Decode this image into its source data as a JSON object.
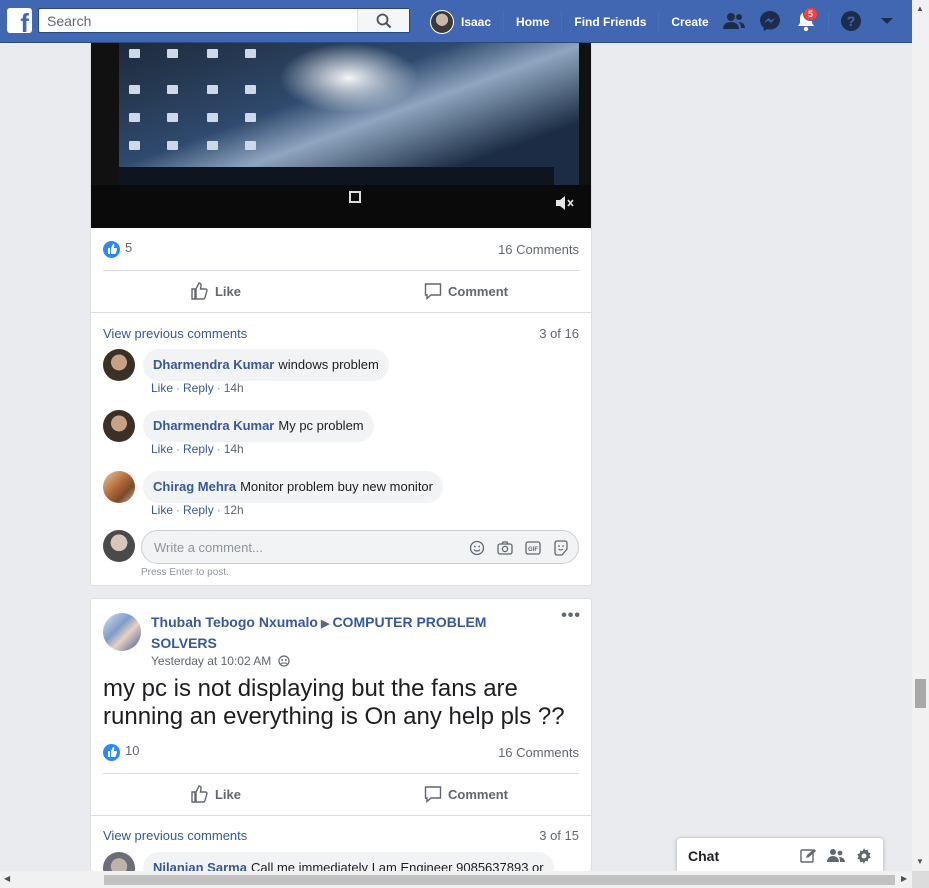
{
  "topbar": {
    "search_placeholder": "Search",
    "user_name": "Isaac",
    "nav": [
      "Home",
      "Find Friends",
      "Create"
    ],
    "notifications_count": "5"
  },
  "post1": {
    "likes": "5",
    "comments_count": "16 Comments",
    "like_label": "Like",
    "comment_label": "Comment",
    "view_previous": "View previous comments",
    "page_indicator": "3 of 16",
    "comments": [
      {
        "name": "Dharmendra Kumar",
        "text": "windows problem",
        "like": "Like",
        "reply": "Reply",
        "time": "14h"
      },
      {
        "name": "Dharmendra Kumar",
        "text": "My pc problem",
        "like": "Like",
        "reply": "Reply",
        "time": "14h"
      },
      {
        "name": "Chirag Mehra",
        "text": "Monitor problem buy new monitor",
        "like": "Like",
        "reply": "Reply",
        "time": "12h"
      }
    ],
    "write_placeholder": "Write a comment...",
    "hint": "Press Enter to post."
  },
  "post2": {
    "author": "Thubah Tebogo Nxumalo",
    "group": "COMPUTER PROBLEM SOLVERS",
    "time": "Yesterday at 10:02 AM",
    "text": "my pc is not displaying but the fans are running an everything is On any help pls ??",
    "likes": "10",
    "comments_count": "16 Comments",
    "like_label": "Like",
    "comment_label": "Comment",
    "view_previous": "View previous comments",
    "page_indicator": "3 of 15",
    "first_comment": {
      "name": "Nilanjan Sarma",
      "text": "Call me immediately I am Engineer 9085637893 or"
    }
  },
  "chat": {
    "label": "Chat"
  },
  "colors": {
    "brand": "#4267b2",
    "link": "#385898",
    "like_blue": "#2d88ff",
    "badge": "#fa3e3e"
  }
}
